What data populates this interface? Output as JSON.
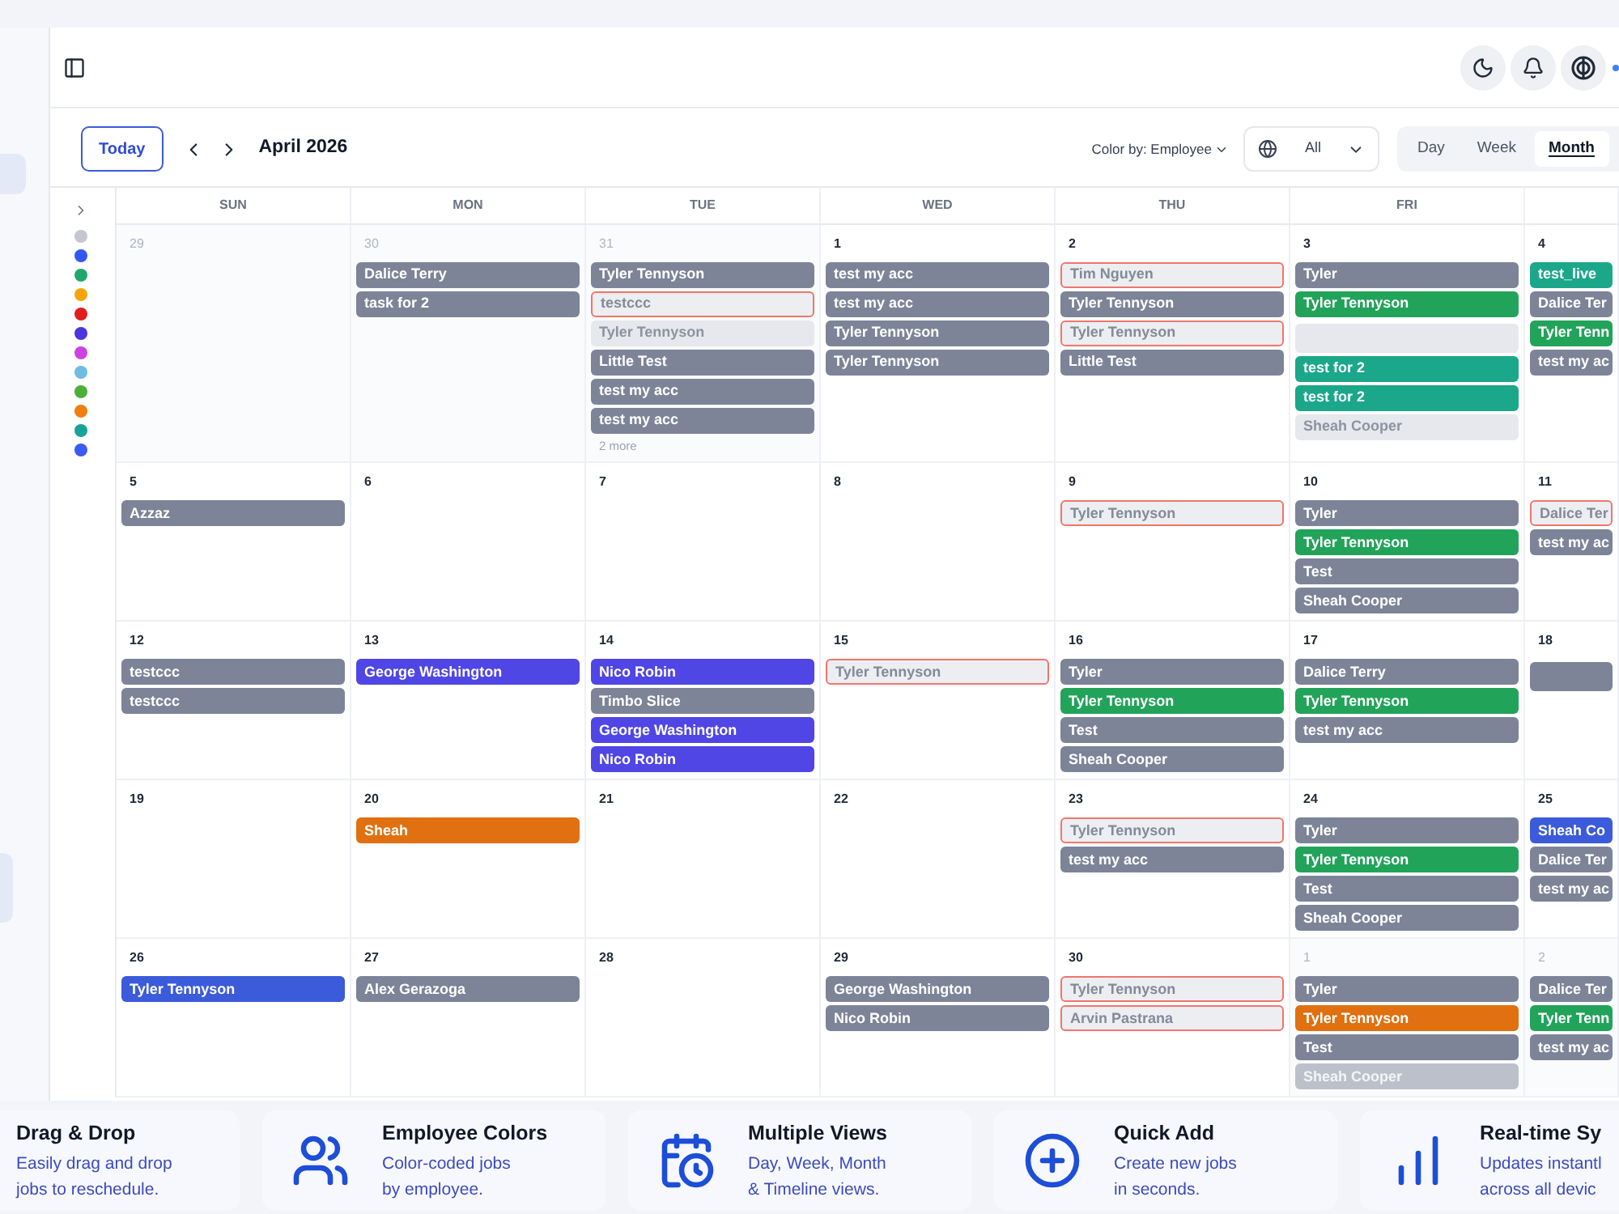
{
  "toolbar": {
    "today": "Today",
    "month": "April 2026",
    "color_by": "Color by: Employee",
    "filter": "All",
    "views": [
      {
        "label": "Day",
        "selected": false
      },
      {
        "label": "Week",
        "selected": false
      },
      {
        "label": "Month",
        "selected": true
      }
    ]
  },
  "legend": {
    "dots": [
      {
        "color": "#c4c7cf"
      },
      {
        "color": "#3358f0"
      },
      {
        "color": "#1fa86b"
      },
      {
        "color": "#f5a50b"
      },
      {
        "color": "#e11d1d"
      },
      {
        "color": "#4a35e0"
      },
      {
        "color": "#cc44e0"
      },
      {
        "color": "#6cbde0"
      },
      {
        "color": "#4caf3a"
      },
      {
        "color": "#f07d10"
      },
      {
        "color": "#17a39a"
      },
      {
        "color": "#3b5bf0"
      }
    ]
  },
  "calendar": {
    "columns": [
      "SUN",
      "MON",
      "TUE",
      "WED",
      "THU",
      "FRI"
    ],
    "weeks": [
      {
        "days": [
          {
            "date": "29",
            "muted": true
          },
          {
            "date": "30",
            "muted": true,
            "events": [
              {
                "title": "Dalice Terry",
                "kind": "solid",
                "color": "#7d8498"
              },
              {
                "title": "task for 2",
                "kind": "solid",
                "color": "#7d8498"
              }
            ]
          },
          {
            "date": "31",
            "muted": true,
            "more": "2 more",
            "events": [
              {
                "title": "Tyler Tennyson",
                "kind": "solid",
                "color": "#7d8498"
              },
              {
                "title": "testccc",
                "kind": "unconfirmed"
              },
              {
                "title": "Tyler Tennyson",
                "kind": "faded"
              },
              {
                "title": "Little Test",
                "kind": "solid",
                "color": "#7d8498"
              },
              {
                "title": "test my acc",
                "kind": "solid",
                "color": "#7d8498"
              },
              {
                "title": "test my acc",
                "kind": "solid",
                "color": "#7d8498"
              }
            ]
          },
          {
            "date": "1",
            "muted": false,
            "events": [
              {
                "title": "test my acc",
                "kind": "solid",
                "color": "#7d8498"
              },
              {
                "title": "test my acc",
                "kind": "solid",
                "color": "#7d8498"
              },
              {
                "title": "Tyler Tennyson",
                "kind": "solid",
                "color": "#7d8498"
              },
              {
                "title": "Tyler Tennyson",
                "kind": "solid",
                "color": "#7d8498"
              }
            ]
          },
          {
            "date": "2",
            "muted": false,
            "events": [
              {
                "title": "Tim Nguyen",
                "kind": "unconfirmed"
              },
              {
                "title": "Tyler Tennyson",
                "kind": "solid",
                "color": "#7d8498"
              },
              {
                "title": "Tyler Tennyson",
                "kind": "unconfirmed"
              },
              {
                "title": "Little Test",
                "kind": "solid",
                "color": "#7d8498"
              }
            ]
          },
          {
            "date": "3",
            "muted": false,
            "events": [
              {
                "title": "Tyler",
                "kind": "solid",
                "color": "#7d8498"
              },
              {
                "title": "Tyler Tennyson",
                "kind": "solid",
                "color": "#22a35a"
              },
              {
                "kind": "faded"
              },
              {
                "title": "test for 2",
                "kind": "solid",
                "color": "#1aa78a"
              },
              {
                "title": "test for 2",
                "kind": "solid",
                "color": "#1aa78a"
              },
              {
                "title": "Sheah Cooper",
                "kind": "faded"
              }
            ]
          },
          {
            "date": "4",
            "muted": false,
            "events": [
              {
                "title": "test_live",
                "kind": "solid",
                "color": "#1aa78a"
              },
              {
                "title": "Dalice Ter",
                "kind": "solid",
                "color": "#7d8498"
              },
              {
                "title": "Tyler Tenn",
                "kind": "solid",
                "color": "#22a35a"
              },
              {
                "title": "test my ac",
                "kind": "solid",
                "color": "#7d8498"
              }
            ]
          }
        ]
      },
      {
        "days": [
          {
            "date": "5",
            "muted": false,
            "events": [
              {
                "title": "Azzaz",
                "kind": "solid",
                "color": "#7d8498"
              }
            ]
          },
          {
            "date": "6",
            "muted": false
          },
          {
            "date": "7",
            "muted": false
          },
          {
            "date": "8",
            "muted": false
          },
          {
            "date": "9",
            "muted": false,
            "events": [
              {
                "title": "Tyler Tennyson",
                "kind": "unconfirmed"
              }
            ]
          },
          {
            "date": "10",
            "muted": false,
            "events": [
              {
                "title": "Tyler",
                "kind": "solid",
                "color": "#7d8498"
              },
              {
                "title": "Tyler Tennyson",
                "kind": "solid",
                "color": "#22a35a"
              },
              {
                "title": "Test",
                "kind": "solid",
                "color": "#7d8498"
              },
              {
                "title": "Sheah Cooper",
                "kind": "solid",
                "color": "#7d8498"
              }
            ]
          },
          {
            "date": "11",
            "muted": false,
            "events": [
              {
                "title": "Dalice Ter",
                "kind": "unconfirmed"
              },
              {
                "title": "test my ac",
                "kind": "solid",
                "color": "#7d8498"
              }
            ]
          }
        ]
      },
      {
        "days": [
          {
            "date": "12",
            "muted": false,
            "events": [
              {
                "title": "testccc",
                "kind": "solid",
                "color": "#7d8498"
              },
              {
                "title": "testccc",
                "kind": "solid",
                "color": "#7d8498"
              }
            ]
          },
          {
            "date": "13",
            "muted": false,
            "events": [
              {
                "title": "George Washington",
                "kind": "solid",
                "color": "#4f46e5"
              }
            ]
          },
          {
            "date": "14",
            "muted": false,
            "events": [
              {
                "title": "Nico Robin",
                "kind": "solid",
                "color": "#4f46e5"
              },
              {
                "title": "Timbo Slice",
                "kind": "solid",
                "color": "#7d8498"
              },
              {
                "title": "George Washington",
                "kind": "solid",
                "color": "#4f46e5"
              },
              {
                "title": "Nico Robin",
                "kind": "solid",
                "color": "#4f46e5"
              }
            ]
          },
          {
            "date": "15",
            "muted": false,
            "events": [
              {
                "title": "Tyler Tennyson",
                "kind": "unconfirmed"
              }
            ]
          },
          {
            "date": "16",
            "muted": false,
            "events": [
              {
                "title": "Tyler",
                "kind": "solid",
                "color": "#7d8498"
              },
              {
                "title": "Tyler Tennyson",
                "kind": "solid",
                "color": "#22a35a"
              },
              {
                "title": "Test",
                "kind": "solid",
                "color": "#7d8498"
              },
              {
                "title": "Sheah Cooper",
                "kind": "solid",
                "color": "#7d8498"
              }
            ]
          },
          {
            "date": "17",
            "muted": false,
            "events": [
              {
                "title": "Dalice Terry",
                "kind": "solid",
                "color": "#7d8498"
              },
              {
                "title": "Tyler Tennyson",
                "kind": "solid",
                "color": "#22a35a"
              },
              {
                "title": "test my acc",
                "kind": "solid",
                "color": "#7d8498"
              }
            ]
          },
          {
            "date": "18",
            "muted": false,
            "events": [
              {
                "kind": "solid",
                "color": "#7d8498"
              }
            ]
          }
        ]
      },
      {
        "days": [
          {
            "date": "19",
            "muted": false
          },
          {
            "date": "20",
            "muted": false,
            "events": [
              {
                "title": "Sheah",
                "kind": "solid",
                "color": "#e07010"
              }
            ]
          },
          {
            "date": "21",
            "muted": false
          },
          {
            "date": "22",
            "muted": false
          },
          {
            "date": "23",
            "muted": false,
            "events": [
              {
                "title": "Tyler Tennyson",
                "kind": "unconfirmed"
              },
              {
                "title": "test my acc",
                "kind": "solid",
                "color": "#7d8498"
              }
            ]
          },
          {
            "date": "24",
            "muted": false,
            "events": [
              {
                "title": "Tyler",
                "kind": "solid",
                "color": "#7d8498"
              },
              {
                "title": "Tyler Tennyson",
                "kind": "solid",
                "color": "#22a35a"
              },
              {
                "title": "Test",
                "kind": "solid",
                "color": "#7d8498"
              },
              {
                "title": "Sheah Cooper",
                "kind": "solid",
                "color": "#7d8498"
              }
            ]
          },
          {
            "date": "25",
            "muted": false,
            "events": [
              {
                "title": "Sheah Co",
                "kind": "solid",
                "color": "#3b5bdb"
              },
              {
                "title": "Dalice Ter",
                "kind": "solid",
                "color": "#7d8498"
              },
              {
                "title": "test my ac",
                "kind": "solid",
                "color": "#7d8498"
              }
            ]
          }
        ]
      },
      {
        "days": [
          {
            "date": "26",
            "muted": false,
            "events": [
              {
                "title": "Tyler Tennyson",
                "kind": "solid",
                "color": "#3b5bdb"
              }
            ]
          },
          {
            "date": "27",
            "muted": false,
            "events": [
              {
                "title": "Alex Gerazoga",
                "kind": "solid",
                "color": "#7d8498"
              }
            ]
          },
          {
            "date": "28",
            "muted": false
          },
          {
            "date": "29",
            "muted": false,
            "events": [
              {
                "title": "George Washington",
                "kind": "solid",
                "color": "#7d8498"
              },
              {
                "title": "Nico Robin",
                "kind": "solid",
                "color": "#7d8498"
              }
            ]
          },
          {
            "date": "30",
            "muted": false,
            "events": [
              {
                "title": "Tyler Tennyson",
                "kind": "unconfirmed"
              },
              {
                "title": "Arvin Pastrana",
                "kind": "unconfirmed"
              }
            ]
          },
          {
            "date": "1",
            "muted": true,
            "events": [
              {
                "title": "Tyler",
                "kind": "solid",
                "color": "#7d8498"
              },
              {
                "title": "Tyler Tennyson",
                "kind": "solid",
                "color": "#e07010"
              },
              {
                "title": "Test",
                "kind": "solid",
                "color": "#7d8498"
              },
              {
                "title": "Sheah Cooper",
                "kind": "dimmed"
              }
            ]
          },
          {
            "date": "2",
            "muted": true,
            "events": [
              {
                "title": "Dalice Ter",
                "kind": "solid",
                "color": "#7d8498"
              },
              {
                "title": "Tyler Tenn",
                "kind": "solid",
                "color": "#22a35a"
              },
              {
                "title": "test my ac",
                "kind": "solid",
                "color": "#7d8498"
              }
            ]
          }
        ]
      }
    ]
  },
  "features": [
    {
      "title": "Drag & Drop",
      "description": "Easily drag and drop\njobs to reschedule."
    },
    {
      "title": "Employee Colors",
      "description": "Color-coded jobs\nby employee."
    },
    {
      "title": "Multiple Views",
      "description": "Day, Week, Month\n& Timeline views."
    },
    {
      "title": "Quick Add",
      "description": "Create new jobs\nin seconds."
    },
    {
      "title": "Real-time Sy",
      "description": "Updates instantl\nacross all devic"
    }
  ]
}
